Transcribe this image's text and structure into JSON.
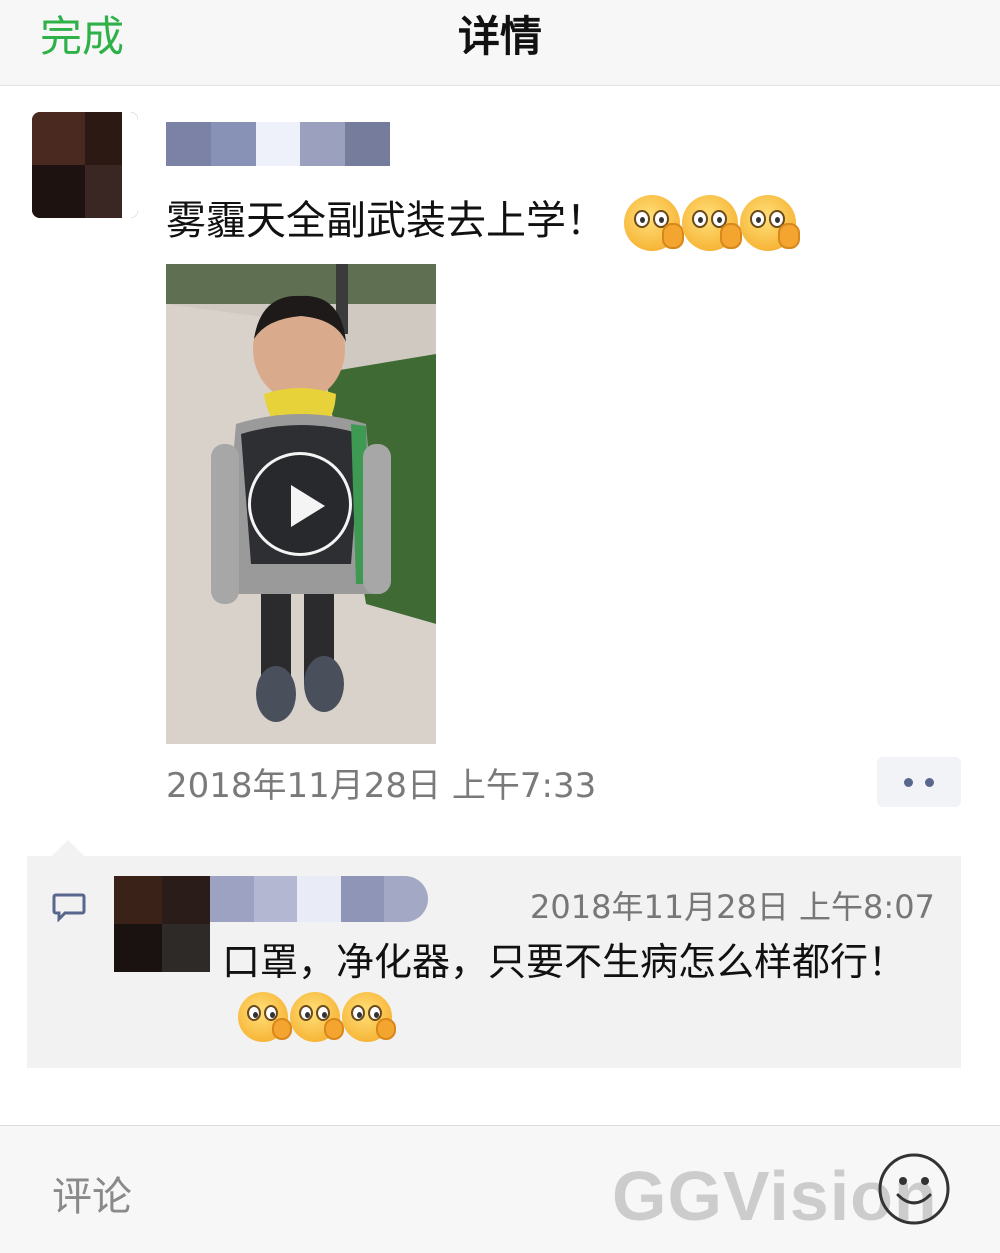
{
  "nav": {
    "done_label": "完成",
    "title": "详情"
  },
  "post": {
    "text": "雾霾天全副武装去上学！",
    "timestamp": "2018年11月28日 上午7:33",
    "emoji_name": "facepalm-emoji"
  },
  "comment": {
    "time": "2018年11月28日 上午8:07",
    "text": "口罩，净化器，只要不生病怎么样都行！"
  },
  "bottom": {
    "comment_placeholder": "评论",
    "watermark": "GGVision"
  },
  "colors": {
    "accent_green": "#2fb14a",
    "link_blue": "#58678e",
    "comment_bg": "#f2f2f2"
  }
}
